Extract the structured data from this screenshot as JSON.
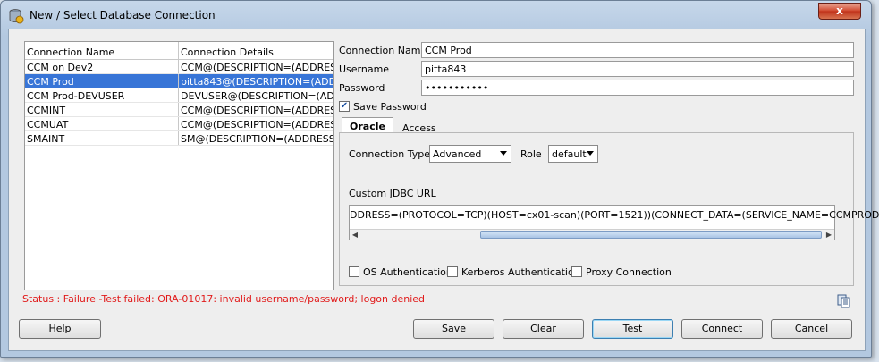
{
  "window": {
    "title": "New / Select Database Connection",
    "close_label": "x"
  },
  "table": {
    "headers": [
      "Connection Name",
      "Connection Details"
    ],
    "rows": [
      [
        "CCM on Dev2",
        "CCM@(DESCRIPTION=(ADDRESS"
      ],
      [
        "CCM Prod",
        "pitta843@(DESCRIPTION=(ADD..."
      ],
      [
        "CCM Prod-DEVUSER",
        "DEVUSER@(DESCRIPTION=(AD..."
      ],
      [
        "CCMINT",
        "CCM@(DESCRIPTION=(ADDRES..."
      ],
      [
        "CCMUAT",
        "CCM@(DESCRIPTION=(ADDRES..."
      ],
      [
        "SMAINT",
        "SM@(DESCRIPTION=(ADDRESS ..."
      ]
    ],
    "selected_index": 1
  },
  "form": {
    "connection_name_label": "Connection Name",
    "connection_name_value": "CCM Prod",
    "username_label": "Username",
    "username_value": "pitta843",
    "password_label": "Password",
    "password_value": "•••••••••••",
    "save_password_label": "Save Password",
    "save_password_checked": true
  },
  "tabs": [
    {
      "label": "Oracle",
      "active": true
    },
    {
      "label": "Access",
      "active": false
    }
  ],
  "oracle": {
    "connection_type_label": "Connection Type",
    "connection_type_value": "Advanced",
    "role_label": "Role",
    "role_value": "default",
    "jdbc_label": "Custom JDBC URL",
    "jdbc_value": "DDRESS=(PROTOCOL=TCP)(HOST=cx01-scan)(PORT=1521))(CONNECT_DATA=(SERVICE_NAME=CCMPROD)))",
    "os_auth_label": "OS Authentication",
    "kerberos_label": "Kerberos Authentication",
    "proxy_label": "Proxy Connection"
  },
  "status": "Status : Failure -Test failed: ORA-01017: invalid username/password; logon denied",
  "buttons": {
    "help": "Help",
    "save": "Save",
    "clear": "Clear",
    "test": "Test",
    "connect": "Connect",
    "cancel": "Cancel"
  },
  "colors": {
    "selection": "#3875d7",
    "status_error": "#e11b1b"
  }
}
